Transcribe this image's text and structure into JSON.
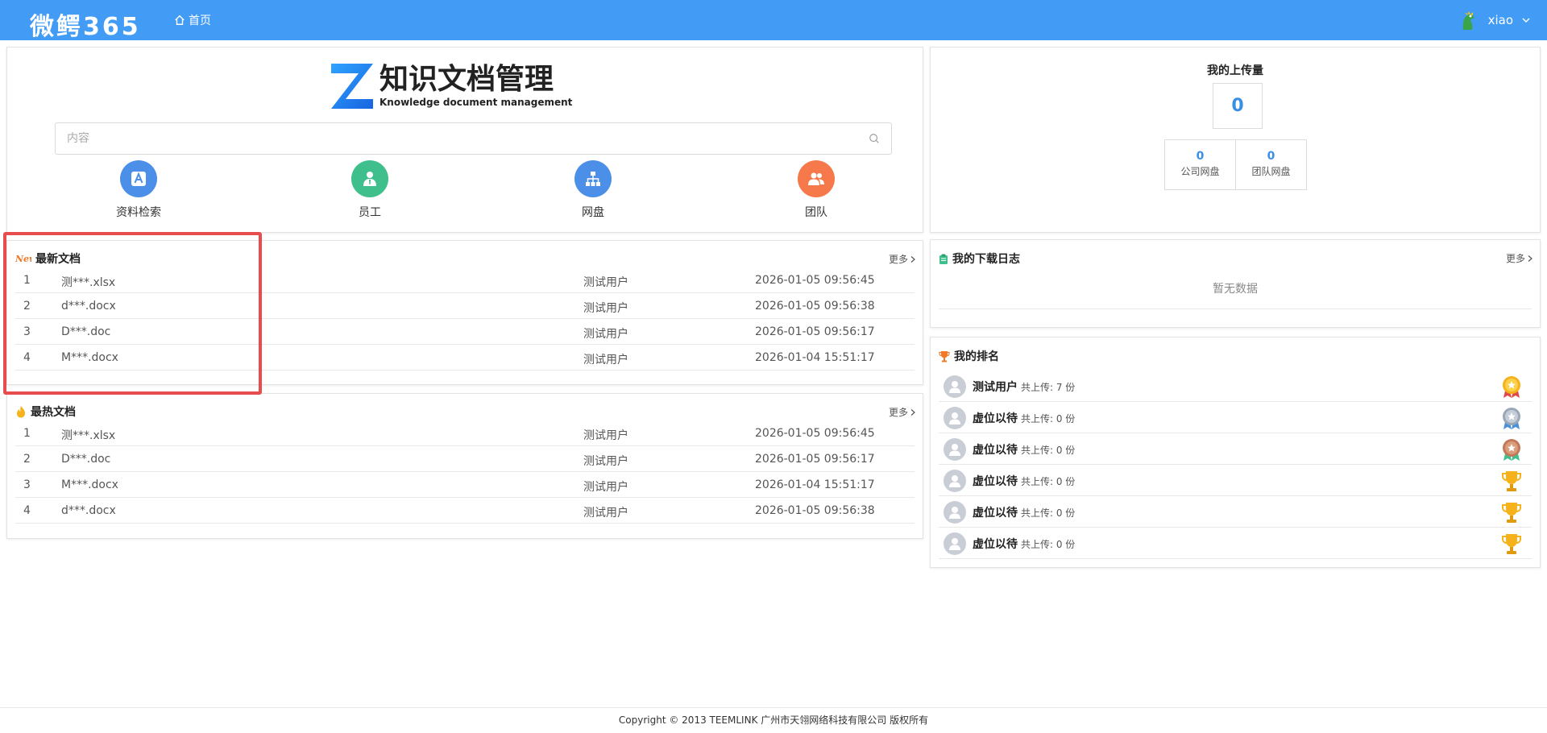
{
  "header": {
    "logo": "微鳄365",
    "nav_home": "首页",
    "username": "xiao"
  },
  "hero": {
    "title": "知识文档管理",
    "subtitle": "Knowledge document management",
    "search_placeholder": "内容",
    "shortcuts": [
      "资料检索",
      "员工",
      "网盘",
      "团队"
    ]
  },
  "latest": {
    "title": "最新文档",
    "more": "更多",
    "rows": [
      {
        "idx": "1",
        "file": "测***.xlsx",
        "user": "测试用户",
        "time": "2026-01-05 09:56:45"
      },
      {
        "idx": "2",
        "file": "d***.docx",
        "user": "测试用户",
        "time": "2026-01-05 09:56:38"
      },
      {
        "idx": "3",
        "file": "D***.doc",
        "user": "测试用户",
        "time": "2026-01-05 09:56:17"
      },
      {
        "idx": "4",
        "file": "M***.docx",
        "user": "测试用户",
        "time": "2026-01-04 15:51:17"
      }
    ]
  },
  "hottest": {
    "title": "最热文档",
    "more": "更多",
    "rows": [
      {
        "idx": "1",
        "file": "测***.xlsx",
        "user": "测试用户",
        "time": "2026-01-05 09:56:45"
      },
      {
        "idx": "2",
        "file": "D***.doc",
        "user": "测试用户",
        "time": "2026-01-05 09:56:17"
      },
      {
        "idx": "3",
        "file": "M***.docx",
        "user": "测试用户",
        "time": "2026-01-04 15:51:17"
      },
      {
        "idx": "4",
        "file": "d***.docx",
        "user": "测试用户",
        "time": "2026-01-05 09:56:38"
      }
    ]
  },
  "upload": {
    "title": "我的上传量",
    "total": "0",
    "company_count": "0",
    "company_label": "公司网盘",
    "team_count": "0",
    "team_label": "团队网盘"
  },
  "download_log": {
    "title": "我的下载日志",
    "more": "更多",
    "empty": "暂无数据"
  },
  "ranking": {
    "title": "我的排名",
    "rows": [
      {
        "name": "测试用户",
        "count": "共上传: 7 份"
      },
      {
        "name": "虚位以待",
        "count": "共上传: 0 份"
      },
      {
        "name": "虚位以待",
        "count": "共上传: 0 份"
      },
      {
        "name": "虚位以待",
        "count": "共上传: 0 份"
      },
      {
        "name": "虚位以待",
        "count": "共上传: 0 份"
      },
      {
        "name": "虚位以待",
        "count": "共上传: 0 份"
      }
    ]
  },
  "footer": "Copyright © 2013 TEEMLINK 广州市天翎网络科技有限公司 版权所有",
  "colors": {
    "header": "#429bf5",
    "accent": "#3a8ee6",
    "highlight": "#e84d4d"
  }
}
